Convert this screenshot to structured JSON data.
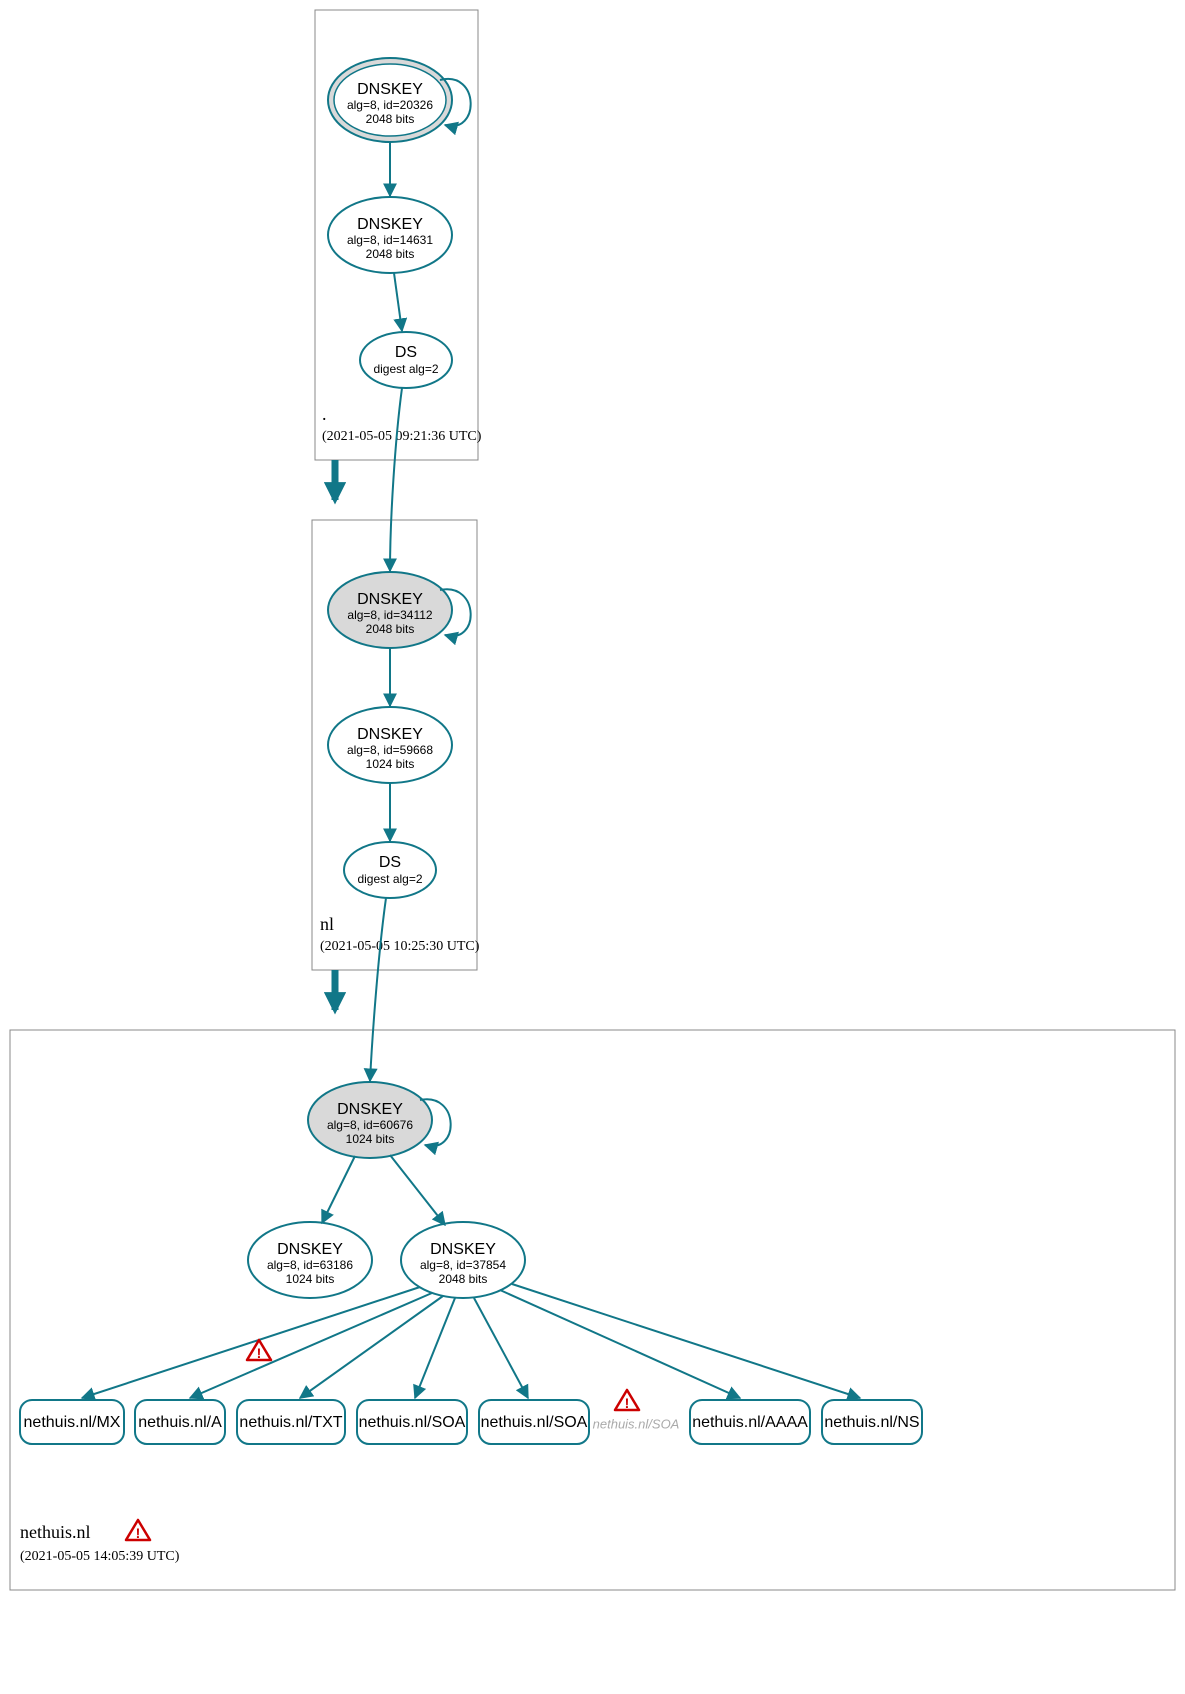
{
  "chart_data": {
    "type": "graph",
    "description": "DNSSEC authentication chain / delegation graph",
    "zones": [
      {
        "id": "root",
        "label": ".",
        "timestamp": "(2021-05-05 09:21:36 UTC)",
        "nodes": [
          {
            "id": "root_ksk",
            "type": "DNSKEY",
            "title": "DNSKEY",
            "sub1": "alg=8, id=20326",
            "sub2": "2048 bits",
            "trustAnchor": true,
            "selfLoop": true
          },
          {
            "id": "root_zsk",
            "type": "DNSKEY",
            "title": "DNSKEY",
            "sub1": "alg=8, id=14631",
            "sub2": "2048 bits"
          },
          {
            "id": "root_ds",
            "type": "DS",
            "title": "DS",
            "sub1": "digest alg=2"
          }
        ]
      },
      {
        "id": "nl",
        "label": "nl",
        "timestamp": "(2021-05-05 10:25:30 UTC)",
        "nodes": [
          {
            "id": "nl_ksk",
            "type": "DNSKEY",
            "title": "DNSKEY",
            "sub1": "alg=8, id=34112",
            "sub2": "2048 bits",
            "selfLoop": true,
            "sep": true
          },
          {
            "id": "nl_zsk",
            "type": "DNSKEY",
            "title": "DNSKEY",
            "sub1": "alg=8, id=59668",
            "sub2": "1024 bits"
          },
          {
            "id": "nl_ds",
            "type": "DS",
            "title": "DS",
            "sub1": "digest alg=2"
          }
        ]
      },
      {
        "id": "nethuis",
        "label": "nethuis.nl",
        "timestamp": "(2021-05-05 14:05:39 UTC)",
        "warning": true,
        "nodes": [
          {
            "id": "neth_ksk",
            "type": "DNSKEY",
            "title": "DNSKEY",
            "sub1": "alg=8, id=60676",
            "sub2": "1024 bits",
            "selfLoop": true,
            "sep": true
          },
          {
            "id": "neth_zsk1",
            "type": "DNSKEY",
            "title": "DNSKEY",
            "sub1": "alg=8, id=63186",
            "sub2": "1024 bits"
          },
          {
            "id": "neth_zsk2",
            "type": "DNSKEY",
            "title": "DNSKEY",
            "sub1": "alg=8, id=37854",
            "sub2": "2048 bits"
          }
        ],
        "rrsets": [
          {
            "id": "rr_mx",
            "label": "nethuis.nl/MX"
          },
          {
            "id": "rr_a",
            "label": "nethuis.nl/A"
          },
          {
            "id": "rr_txt",
            "label": "nethuis.nl/TXT"
          },
          {
            "id": "rr_soa1",
            "label": "nethuis.nl/SOA"
          },
          {
            "id": "rr_soa2",
            "label": "nethuis.nl/SOA"
          },
          {
            "id": "rr_soa3",
            "label": "nethuis.nl/SOA",
            "faded": true,
            "warning": true
          },
          {
            "id": "rr_aaaa",
            "label": "nethuis.nl/AAAA"
          },
          {
            "id": "rr_ns",
            "label": "nethuis.nl/NS"
          }
        ]
      }
    ],
    "edges": [
      {
        "from": "root_ksk",
        "to": "root_zsk"
      },
      {
        "from": "root_zsk",
        "to": "root_ds"
      },
      {
        "from": "root_ds",
        "to": "nl_ksk"
      },
      {
        "from": "root",
        "to": "nl",
        "thick": true
      },
      {
        "from": "nl_ksk",
        "to": "nl_zsk"
      },
      {
        "from": "nl_zsk",
        "to": "nl_ds"
      },
      {
        "from": "nl_ds",
        "to": "neth_ksk"
      },
      {
        "from": "nl",
        "to": "nethuis",
        "thick": true
      },
      {
        "from": "neth_ksk",
        "to": "neth_zsk1"
      },
      {
        "from": "neth_ksk",
        "to": "neth_zsk2"
      },
      {
        "from": "neth_zsk2",
        "to": "rr_mx",
        "warning": true
      },
      {
        "from": "neth_zsk2",
        "to": "rr_a"
      },
      {
        "from": "neth_zsk2",
        "to": "rr_txt"
      },
      {
        "from": "neth_zsk2",
        "to": "rr_soa1"
      },
      {
        "from": "neth_zsk2",
        "to": "rr_soa2"
      },
      {
        "from": "neth_zsk2",
        "to": "rr_aaaa"
      },
      {
        "from": "neth_zsk2",
        "to": "rr_ns"
      }
    ]
  },
  "colors": {
    "stroke": "#117788",
    "warn": "#c00",
    "sep_fill": "#d9d9d9"
  }
}
